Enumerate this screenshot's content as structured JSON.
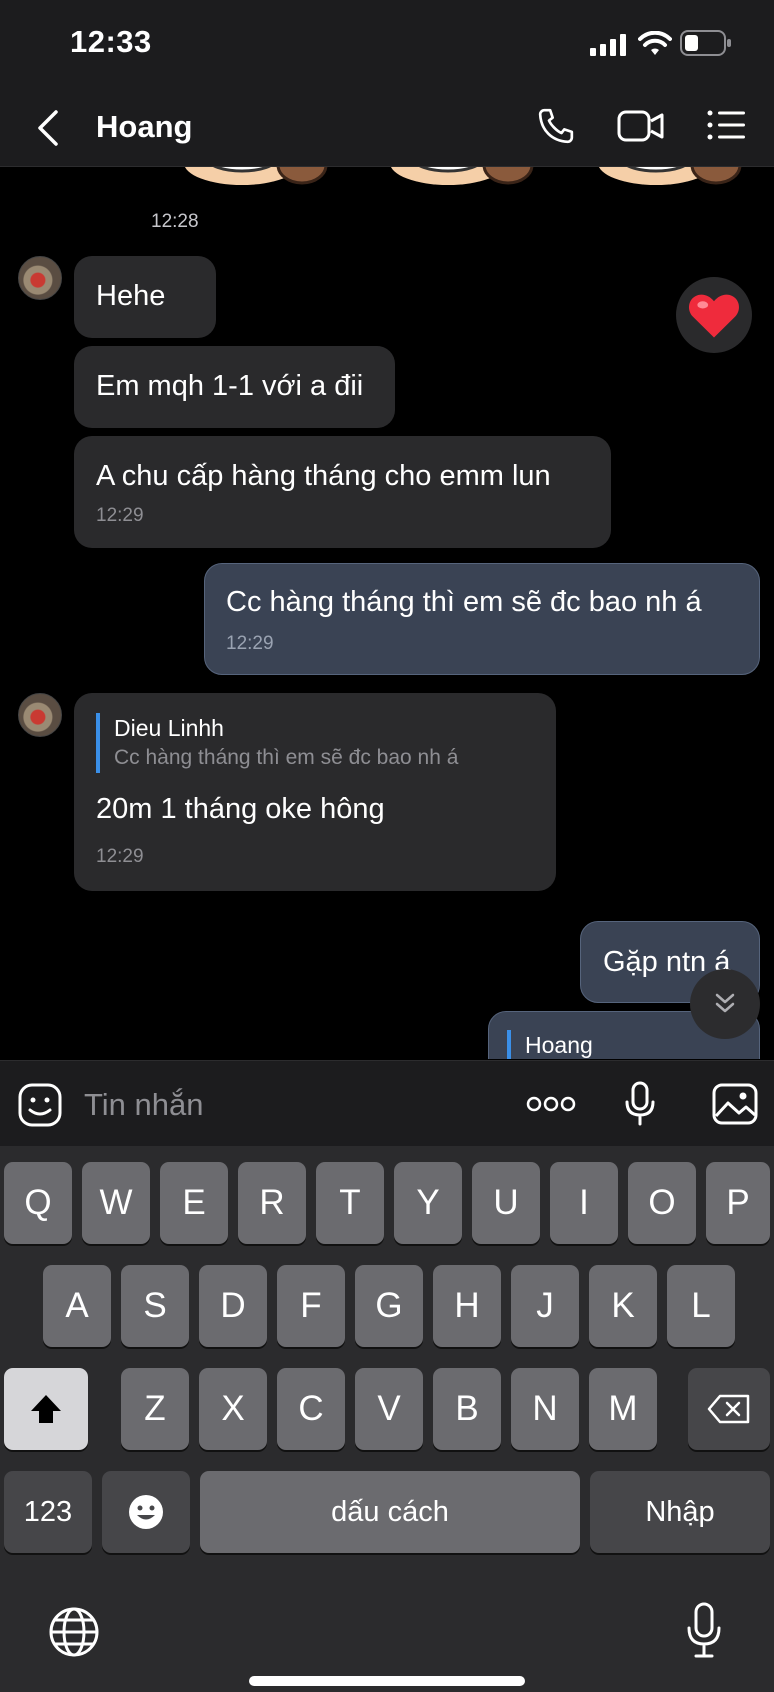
{
  "status_bar": {
    "time": "12:33"
  },
  "header": {
    "title": "Hoang"
  },
  "messages": [
    {
      "time_above": "12:28"
    },
    {
      "text": "Hehe"
    },
    {
      "text": "Em mqh 1-1 với a đii"
    },
    {
      "text": "A chu cấp hàng tháng cho emm lun",
      "time": "12:29"
    },
    {
      "text": "Cc hàng tháng thì em sẽ đc bao nh á",
      "time": "12:29"
    },
    {
      "reply_name": "Dieu Linhh",
      "reply_text": "Cc hàng tháng thì em sẽ đc bao nh á",
      "text": "20m 1 tháng oke hông",
      "time": "12:29"
    },
    {
      "text": "Gặp ntn á"
    },
    {
      "reply_name": "Hoang"
    }
  ],
  "input": {
    "placeholder": "Tin nhắn"
  },
  "keyboard": {
    "row1": [
      "Q",
      "W",
      "E",
      "R",
      "T",
      "Y",
      "U",
      "I",
      "O",
      "P"
    ],
    "row2": [
      "A",
      "S",
      "D",
      "F",
      "G",
      "H",
      "J",
      "K",
      "L"
    ],
    "row3": [
      "Z",
      "X",
      "C",
      "V",
      "B",
      "N",
      "M"
    ],
    "numbers_key": "123",
    "space_key": "dấu cách",
    "return_key": "Nhập"
  },
  "icons": {
    "back": "chevron-left-icon",
    "call": "phone-icon",
    "video": "video-icon",
    "menu": "list-icon",
    "reaction": "heart-icon",
    "emoji": "sticker-icon",
    "more": "more-icon",
    "mic": "mic-icon",
    "gallery": "image-icon",
    "scroll_down": "double-chevron-down-icon",
    "globe": "globe-icon"
  }
}
